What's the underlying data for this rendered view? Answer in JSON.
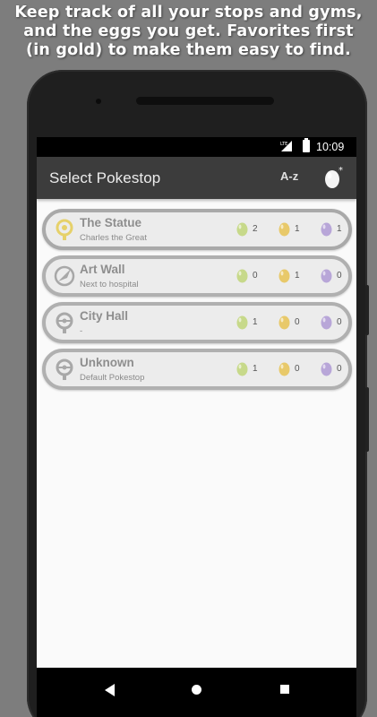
{
  "promo": {
    "line1": "Keep track of all your stops and gyms,",
    "line2": "and the eggs you get. Favorites first",
    "line3": "(in gold) to make them easy to find."
  },
  "status_bar": {
    "network": "LTE",
    "time": "10:09"
  },
  "app_bar": {
    "title": "Select Pokestop",
    "sort_label": "A-z",
    "sort_icon": "sort-alpha-icon",
    "egg_button_icon": "add-egg-icon"
  },
  "stops": [
    {
      "name": "The Statue",
      "subtitle": "Charles the Great",
      "icon": "pokestop-favorite-icon",
      "favorite": true,
      "eggs": [
        {
          "type": "2km",
          "count": "2"
        },
        {
          "type": "5km",
          "count": "1"
        },
        {
          "type": "10km",
          "count": "1"
        }
      ]
    },
    {
      "name": "Art Wall",
      "subtitle": "Next to hospital",
      "icon": "gym-icon",
      "favorite": false,
      "eggs": [
        {
          "type": "2km",
          "count": "0"
        },
        {
          "type": "5km",
          "count": "1"
        },
        {
          "type": "10km",
          "count": "0"
        }
      ]
    },
    {
      "name": "City Hall",
      "subtitle": "-",
      "icon": "pokestop-icon",
      "favorite": false,
      "eggs": [
        {
          "type": "2km",
          "count": "1"
        },
        {
          "type": "5km",
          "count": "0"
        },
        {
          "type": "10km",
          "count": "0"
        }
      ]
    },
    {
      "name": "Unknown",
      "subtitle": "Default Pokestop",
      "icon": "pokestop-icon",
      "favorite": false,
      "eggs": [
        {
          "type": "2km",
          "count": "1"
        },
        {
          "type": "5km",
          "count": "0"
        },
        {
          "type": "10km",
          "count": "0"
        }
      ]
    }
  ],
  "colors": {
    "app_bar": "#3c3c3c",
    "card_border": "#b0b0b0",
    "favorite_icon": "#e6d16a",
    "egg_2km": "#c7d98a",
    "egg_5km": "#e8c96a",
    "egg_10km": "#b8a6d8"
  },
  "nav_bar": {
    "back_icon": "back-icon",
    "home_icon": "home-icon",
    "recents_icon": "recents-icon"
  }
}
